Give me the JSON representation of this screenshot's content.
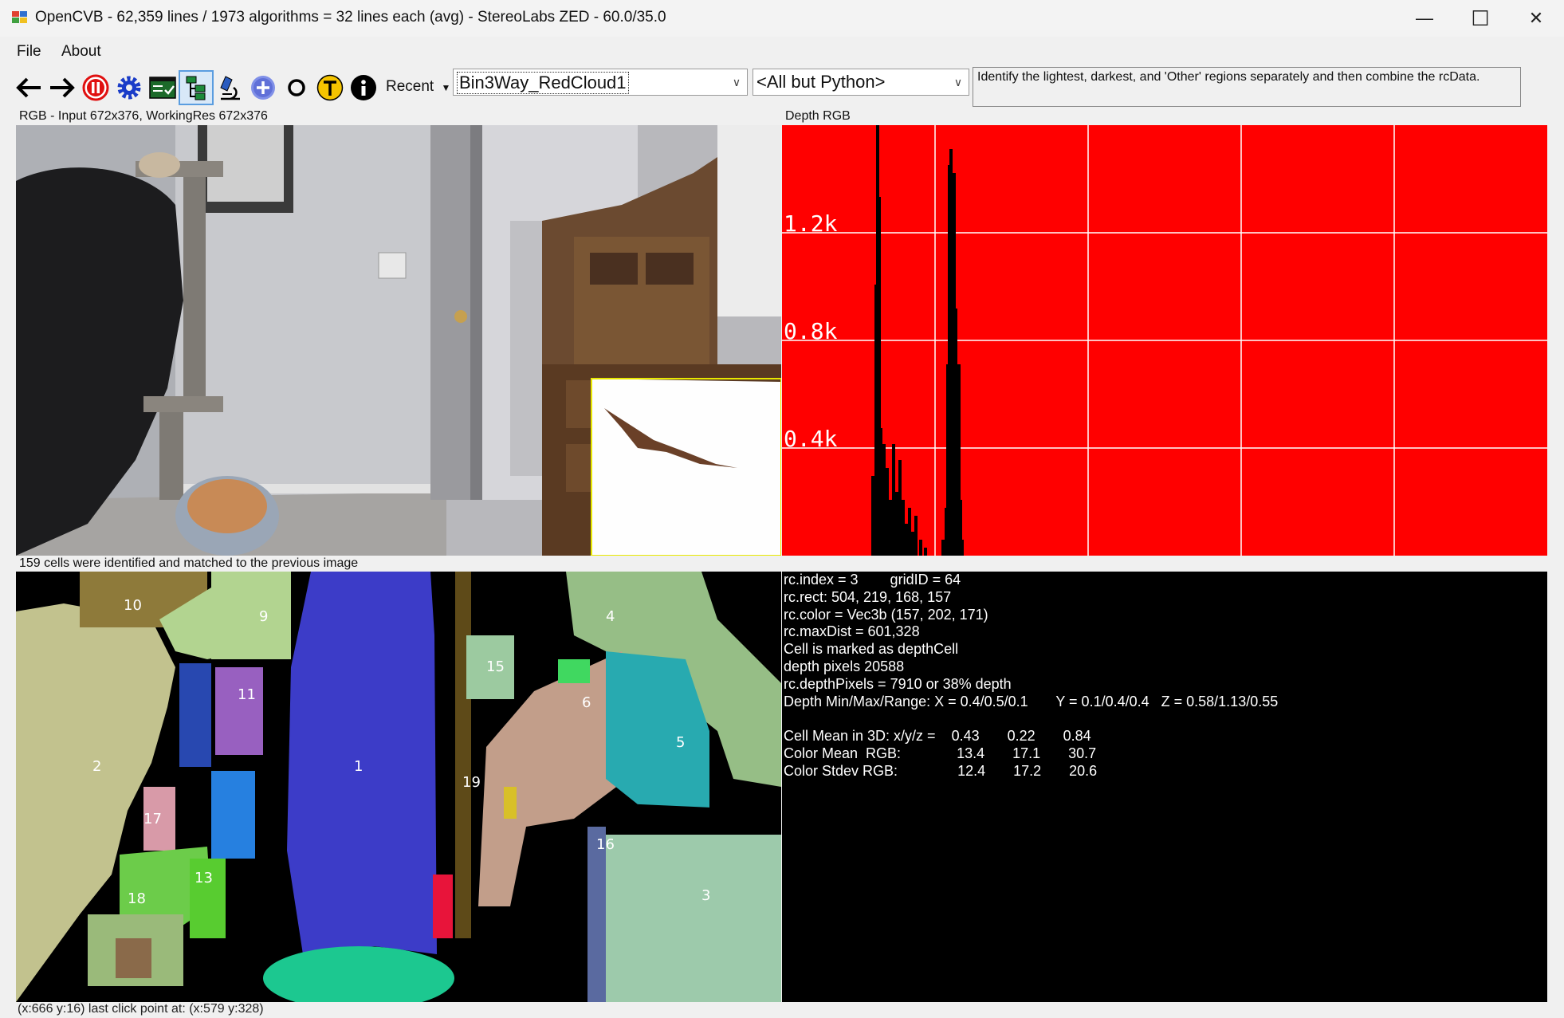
{
  "window": {
    "title": "OpenCVB - 62,359 lines / 1973 algorithms = 32 lines each (avg) - StereoLabs ZED - 60.0/35.0",
    "minimize_glyph": "—",
    "maximize_glyph": "☐",
    "close_glyph": "✕"
  },
  "menu": {
    "file": "File",
    "about": "About"
  },
  "toolbar": {
    "recent_label": "Recent",
    "algorithm_value": "Bin3Way_RedCloud1",
    "group_value": "<All but Python>",
    "description": "Identify the lightest, darkest, and 'Other' regions separately and then combine the rcData.",
    "icons": [
      "back-arrow-icon",
      "forward-arrow-icon",
      "pause-icon",
      "gear-icon",
      "test-all-icon",
      "tree-view-icon",
      "microscope-icon",
      "plus-icon",
      "circle-o-icon",
      "t-icon",
      "info-icon"
    ]
  },
  "panels": {
    "rgb_label": "RGB - Input 672x376, WorkingRes 672x376",
    "depth_label": "Depth RGB",
    "cells_label": "159 cells were identified and matched to the previous image"
  },
  "histogram": {
    "background": "#ff0000",
    "tick_labels": [
      "1.2k",
      "0.8k",
      "0.4k"
    ]
  },
  "cells": {
    "labels": [
      "10",
      "9",
      "4",
      "15",
      "11",
      "6",
      "5",
      "2",
      "1",
      "19",
      "17",
      "16",
      "13",
      "18",
      "3"
    ]
  },
  "cell_info": {
    "lines": [
      "rc.index = 3        gridID = 64",
      "rc.rect: 504, 219, 168, 157",
      "rc.color = Vec3b (157, 202, 171)",
      "rc.maxDist = 601,328",
      "Cell is marked as depthCell",
      "depth pixels 20588",
      "rc.depthPixels = 7910 or 38% depth",
      "Depth Min/Max/Range: X = 0.4/0.5/0.1       Y = 0.1/0.4/0.4   Z = 0.58/1.13/0.55",
      "",
      "Cell Mean in 3D: x/y/z =    0.43       0.22       0.84",
      "Color Mean  RGB:              13.4       17.1       30.7",
      "Color Stdev RGB:               12.4       17.2       20.6"
    ]
  },
  "status": "(x:666 y:16) last click point at: (x:579 y:328)"
}
